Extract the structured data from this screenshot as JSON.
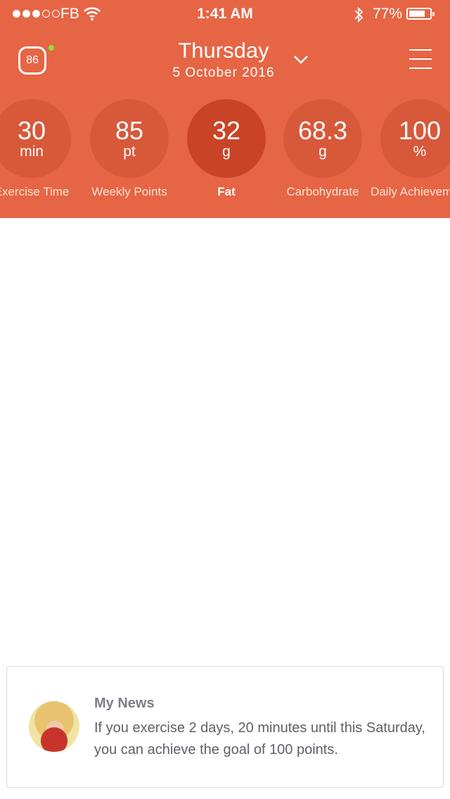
{
  "status_bar": {
    "carrier": "FB",
    "time": "1:41 AM",
    "battery_percent": "77%",
    "battery_level": 0.77,
    "signal_bars_filled": 3,
    "signal_bars_total": 5
  },
  "header": {
    "score_badge": "86",
    "day": "Thursday",
    "date": "5 October 2016",
    "accent_color": "#e66544",
    "online_color": "#8be234"
  },
  "stats": [
    {
      "value": "30",
      "unit": "min",
      "label": "Exercise Time",
      "active": false
    },
    {
      "value": "85",
      "unit": "pt",
      "label": "Weekly Points",
      "active": false
    },
    {
      "value": "32",
      "unit": "g",
      "label": "Fat",
      "active": true
    },
    {
      "value": "68.3",
      "unit": "g",
      "label": "Carbohydrate",
      "active": false
    },
    {
      "value": "100",
      "unit": "%",
      "label": "Daily Achievement",
      "active": false
    }
  ],
  "news": {
    "title": "My News",
    "body": "If you exercise 2 days, 20 minutes until this Saturday, you can achieve the goal of 100 points."
  },
  "icons": [
    "signal-icon",
    "wifi-icon",
    "bluetooth-icon",
    "battery-icon",
    "score-badge-icon",
    "chevron-down-icon",
    "menu-icon",
    "avatar"
  ]
}
